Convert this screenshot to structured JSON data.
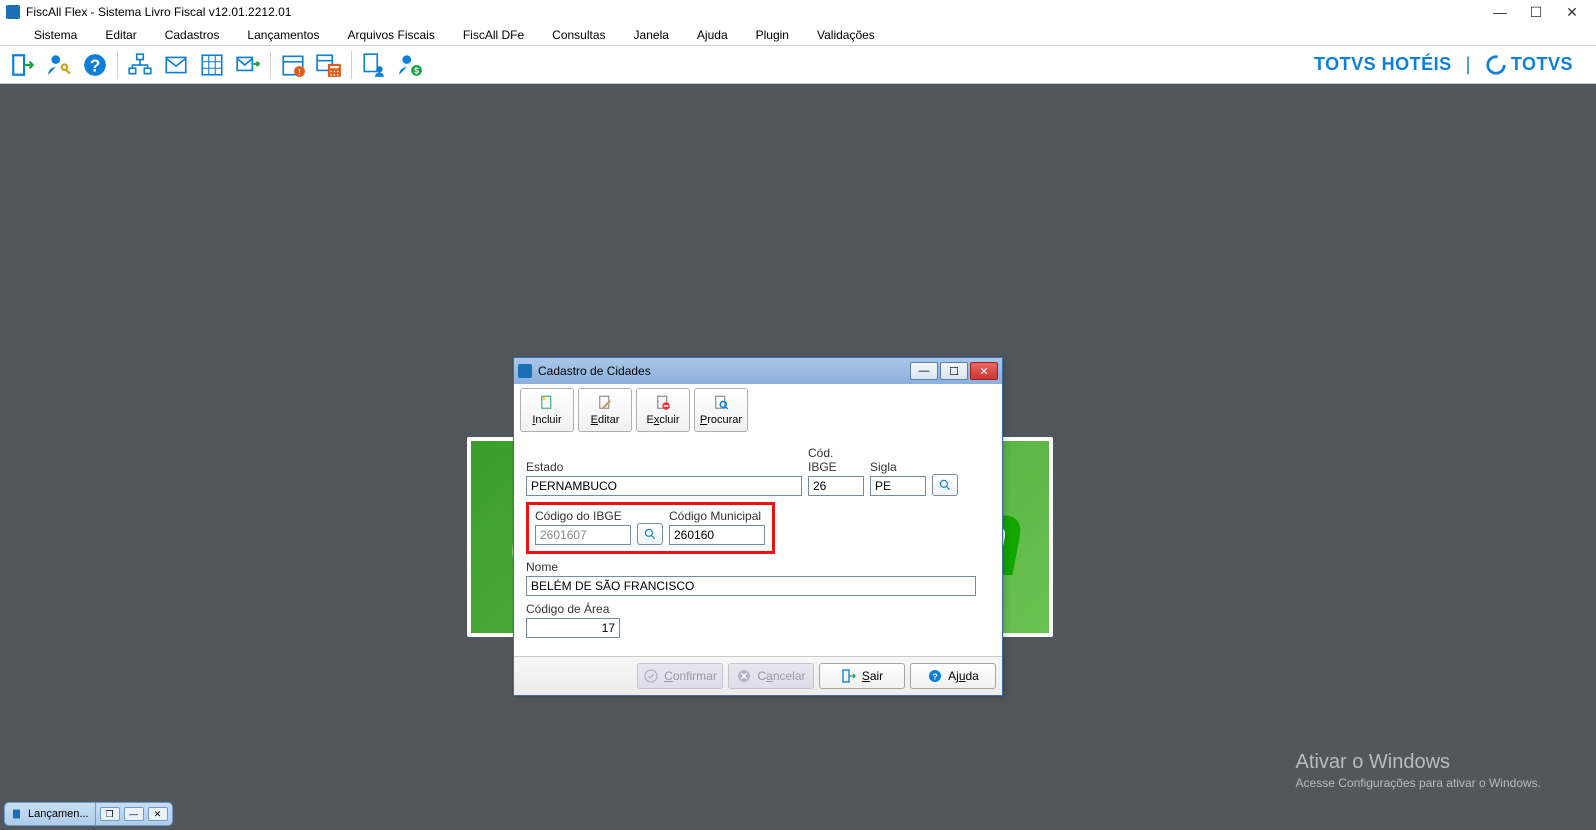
{
  "app": {
    "title": "FiscAll Flex - Sistema Livro Fiscal v12.01.2212.01"
  },
  "menubar": {
    "items": [
      "Sistema",
      "Editar",
      "Cadastros",
      "Lançamentos",
      "Arquivos Fiscais",
      "FiscAll DFe",
      "Consultas",
      "Janela",
      "Ajuda",
      "Plugin",
      "Validações"
    ]
  },
  "brand": {
    "hotel": "TOTVS HOTÉIS",
    "totvs": "TOTVS"
  },
  "dialog": {
    "title": "Cadastro de Cidades",
    "toolbar": {
      "incluir": "Incluir",
      "editar": "Editar",
      "excluir": "Excluir",
      "procurar": "Procurar"
    },
    "labels": {
      "estado": "Estado",
      "cod_ibge": "Cód. IBGE",
      "sigla": "Sigla",
      "codigo_do_ibge": "Código do IBGE",
      "codigo_municipal": "Código Municipal",
      "nome": "Nome",
      "codigo_de_area": "Código de Área"
    },
    "values": {
      "estado": "PERNAMBUCO",
      "cod_ibge": "26",
      "sigla": "PE",
      "codigo_do_ibge": "2601607",
      "codigo_municipal": "260160",
      "nome": "BELÉM DE SÃO FRANCISCO",
      "codigo_de_area": "17"
    },
    "footer": {
      "confirmar": "Confirmar",
      "cancelar": "Cancelar",
      "sair": "Sair",
      "ajuda": "Ajuda"
    }
  },
  "taskbar": {
    "item": "Lançamen..."
  },
  "watermark": {
    "l1": "Ativar o Windows",
    "l2": "Acesse Configurações para ativar o Windows."
  }
}
